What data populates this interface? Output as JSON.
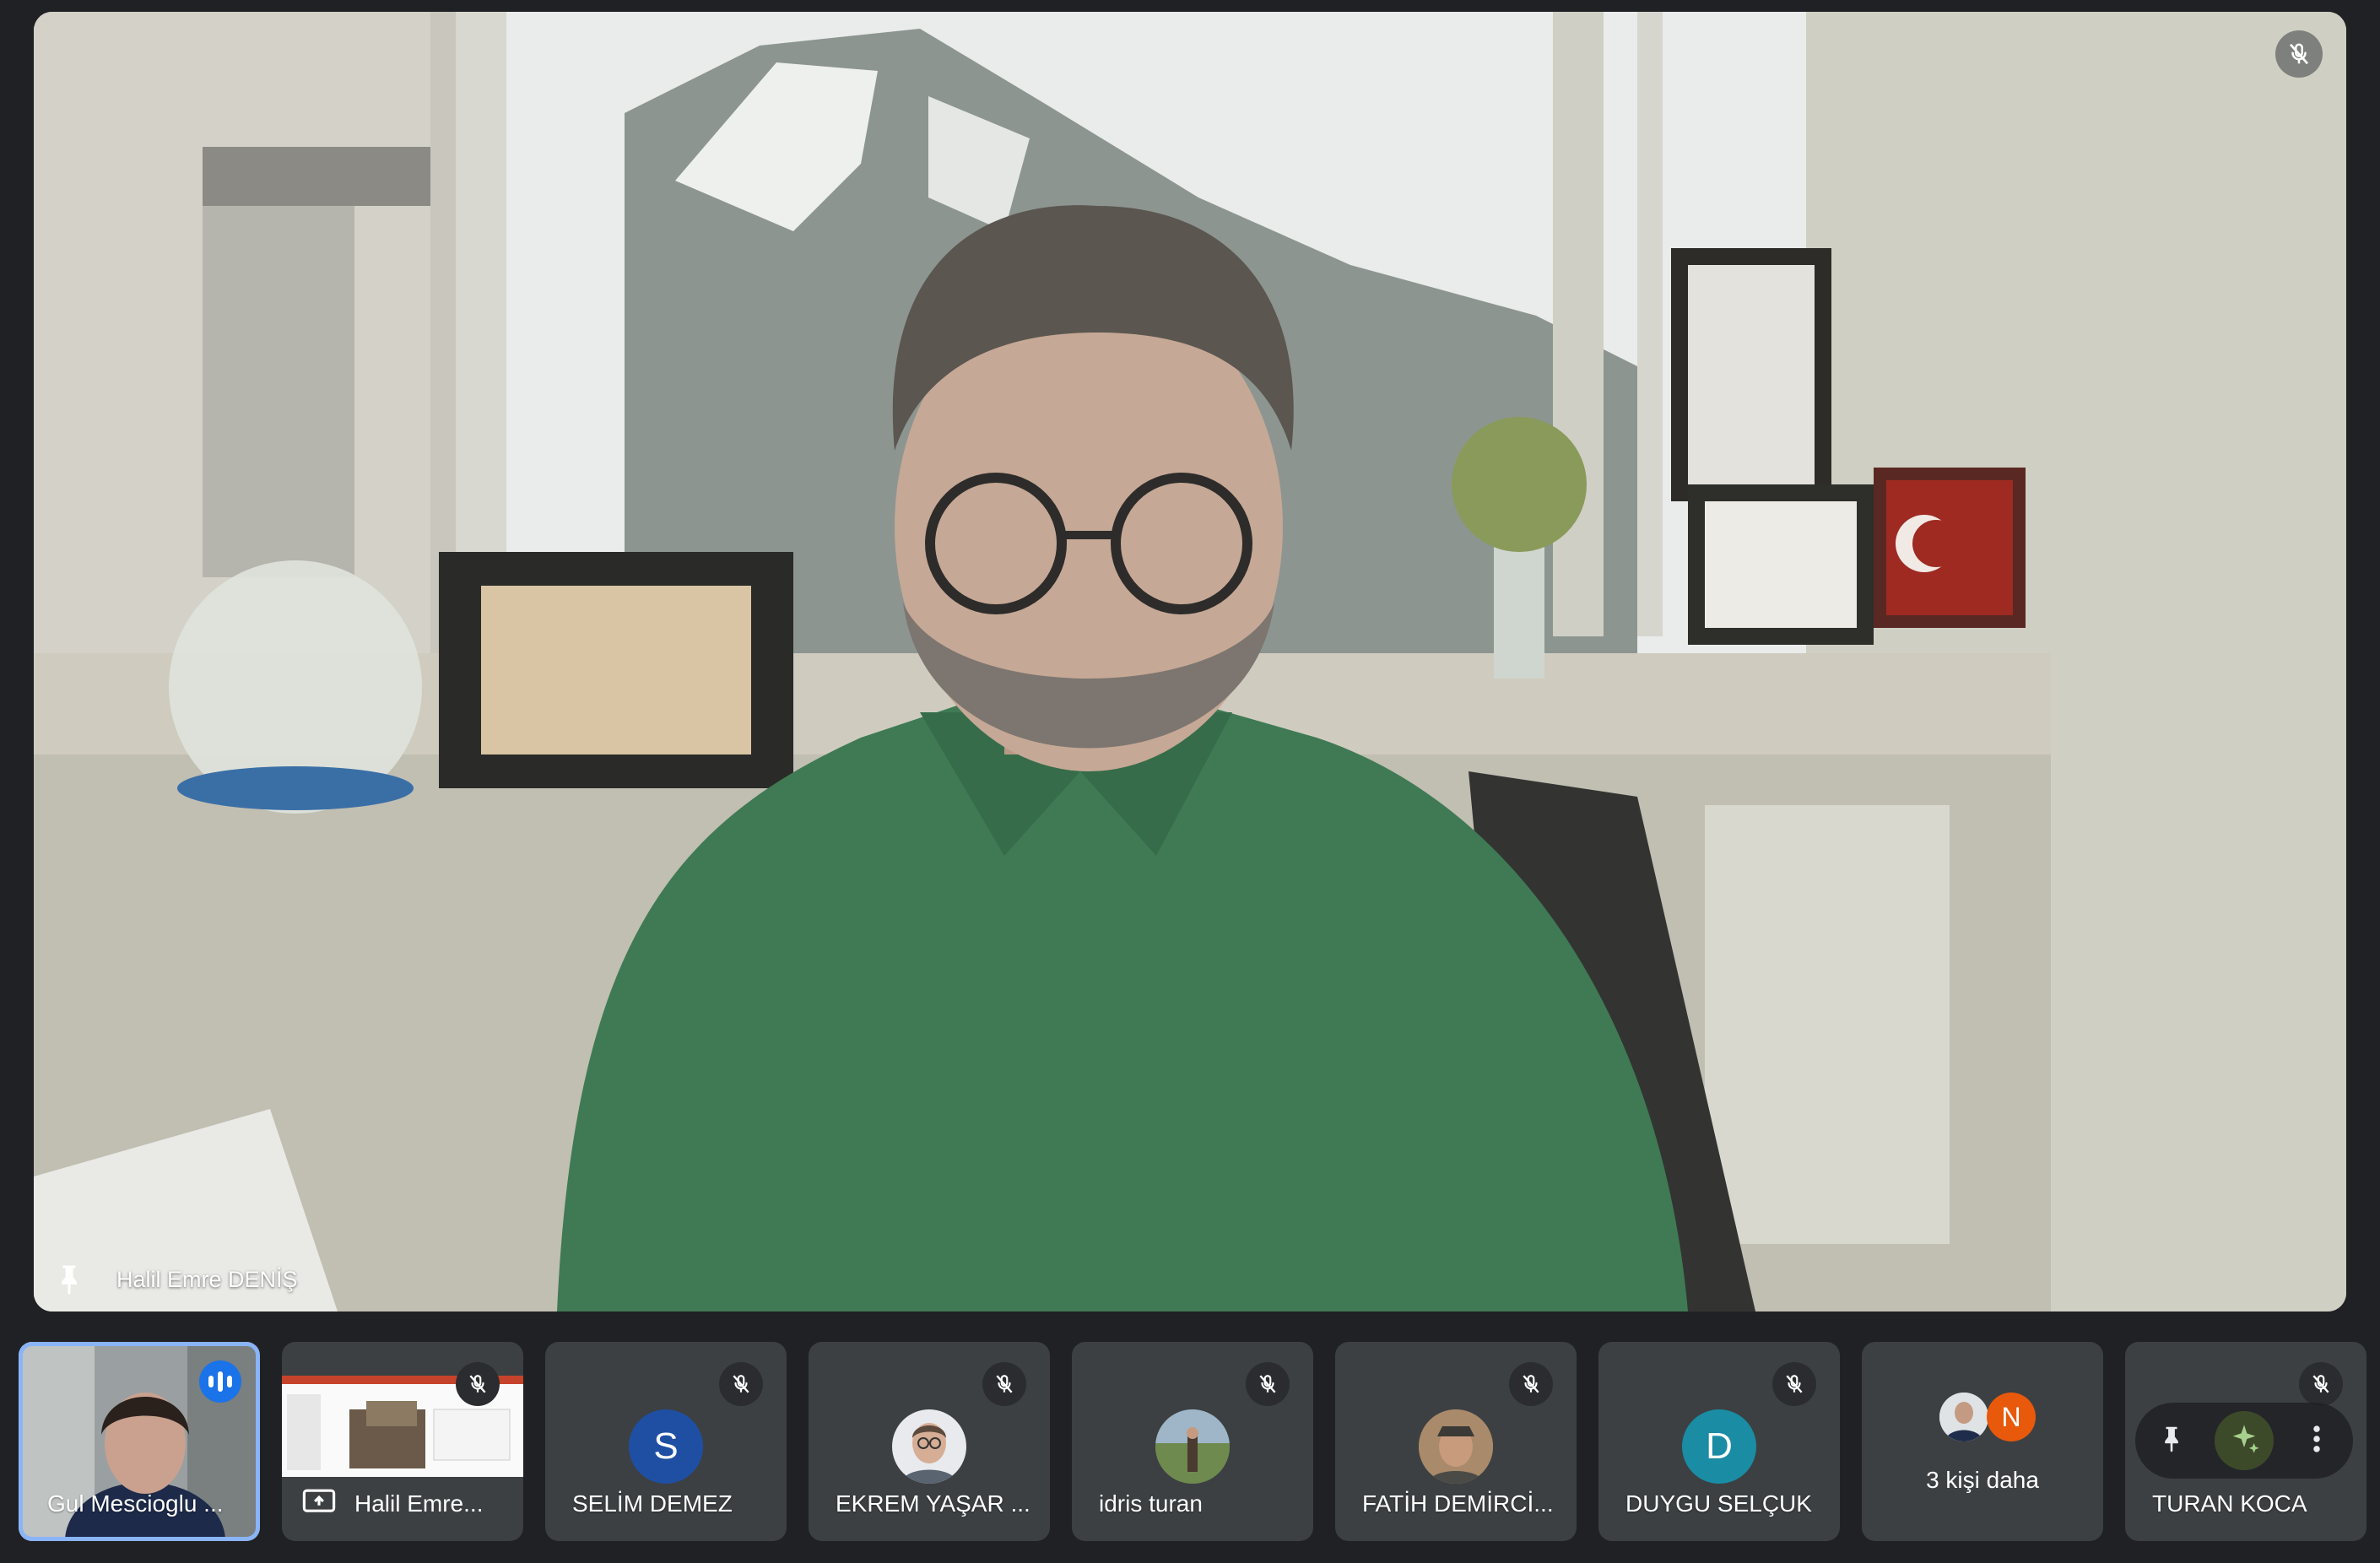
{
  "main": {
    "speaker_name": "Halil Emre DENİŞ",
    "pinned": true,
    "muted": true
  },
  "filmstrip": [
    {
      "name": "Gul Mescioglu ...",
      "type": "video",
      "speaking": true
    },
    {
      "name": "Halil Emre...",
      "type": "presentation",
      "muted": true
    },
    {
      "name": "SELİM DEMEZ",
      "type": "avatar-letter",
      "initial": "S",
      "color": "#1e4fa3",
      "muted": true
    },
    {
      "name": "EKREM YAŞAR ...",
      "type": "avatar-photo",
      "muted": true
    },
    {
      "name": "idris turan",
      "type": "avatar-photo",
      "muted": true
    },
    {
      "name": "FATİH DEMİRCİ...",
      "type": "avatar-photo",
      "muted": true
    },
    {
      "name": "DUYGU SELÇUK",
      "type": "avatar-letter",
      "initial": "D",
      "color": "#1a8ca3",
      "muted": true
    },
    {
      "name": "3 kişi daha",
      "type": "more",
      "extra_initial": "N"
    },
    {
      "name": "TURAN KOCA",
      "type": "hover-controls",
      "muted": true
    }
  ],
  "colors": {
    "background": "#202124",
    "tile": "#3c4043",
    "speaking_accent": "#1a73e8",
    "more_badge": "#e8590c"
  }
}
